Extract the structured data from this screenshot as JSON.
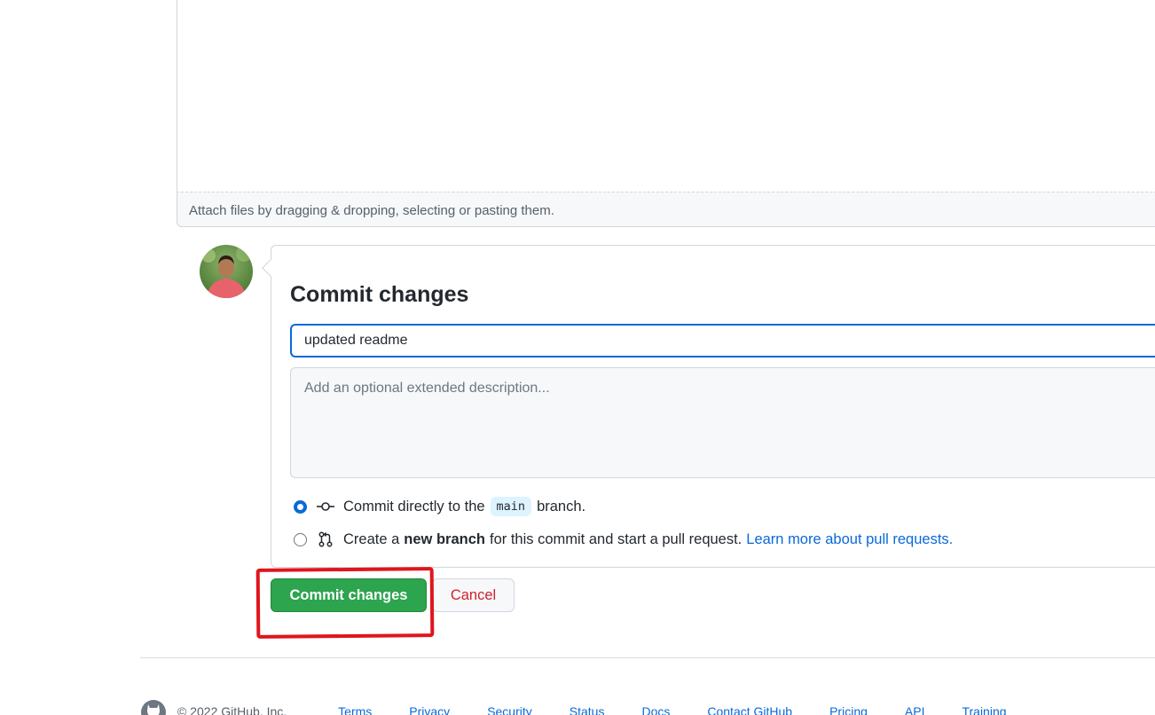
{
  "editor": {
    "attach_hint": "Attach files by dragging & dropping, selecting or pasting them."
  },
  "commit": {
    "title": "Commit changes",
    "summary_value": "updated readme",
    "description_placeholder": "Add an optional extended description...",
    "option_direct": {
      "prefix": "Commit directly to the",
      "branch": "main",
      "suffix": "branch.",
      "selected": true
    },
    "option_new_branch": {
      "prefix": "Create a",
      "bold": "new branch",
      "suffix": "for this commit and start a pull request.",
      "link": "Learn more about pull requests.",
      "selected": false
    },
    "commit_button": "Commit changes",
    "cancel_button": "Cancel"
  },
  "annotation": {
    "color": "#e0151d",
    "target": "commit-changes-button"
  },
  "footer": {
    "copyright": "© 2022 GitHub, Inc.",
    "links": [
      "Terms",
      "Privacy",
      "Security",
      "Status",
      "Docs",
      "Contact GitHub",
      "Pricing",
      "API",
      "Training"
    ]
  },
  "colors": {
    "primary_button": "#2da44e",
    "cancel_text": "#cf222e",
    "link": "#0969da",
    "focus_border": "#0969da"
  }
}
